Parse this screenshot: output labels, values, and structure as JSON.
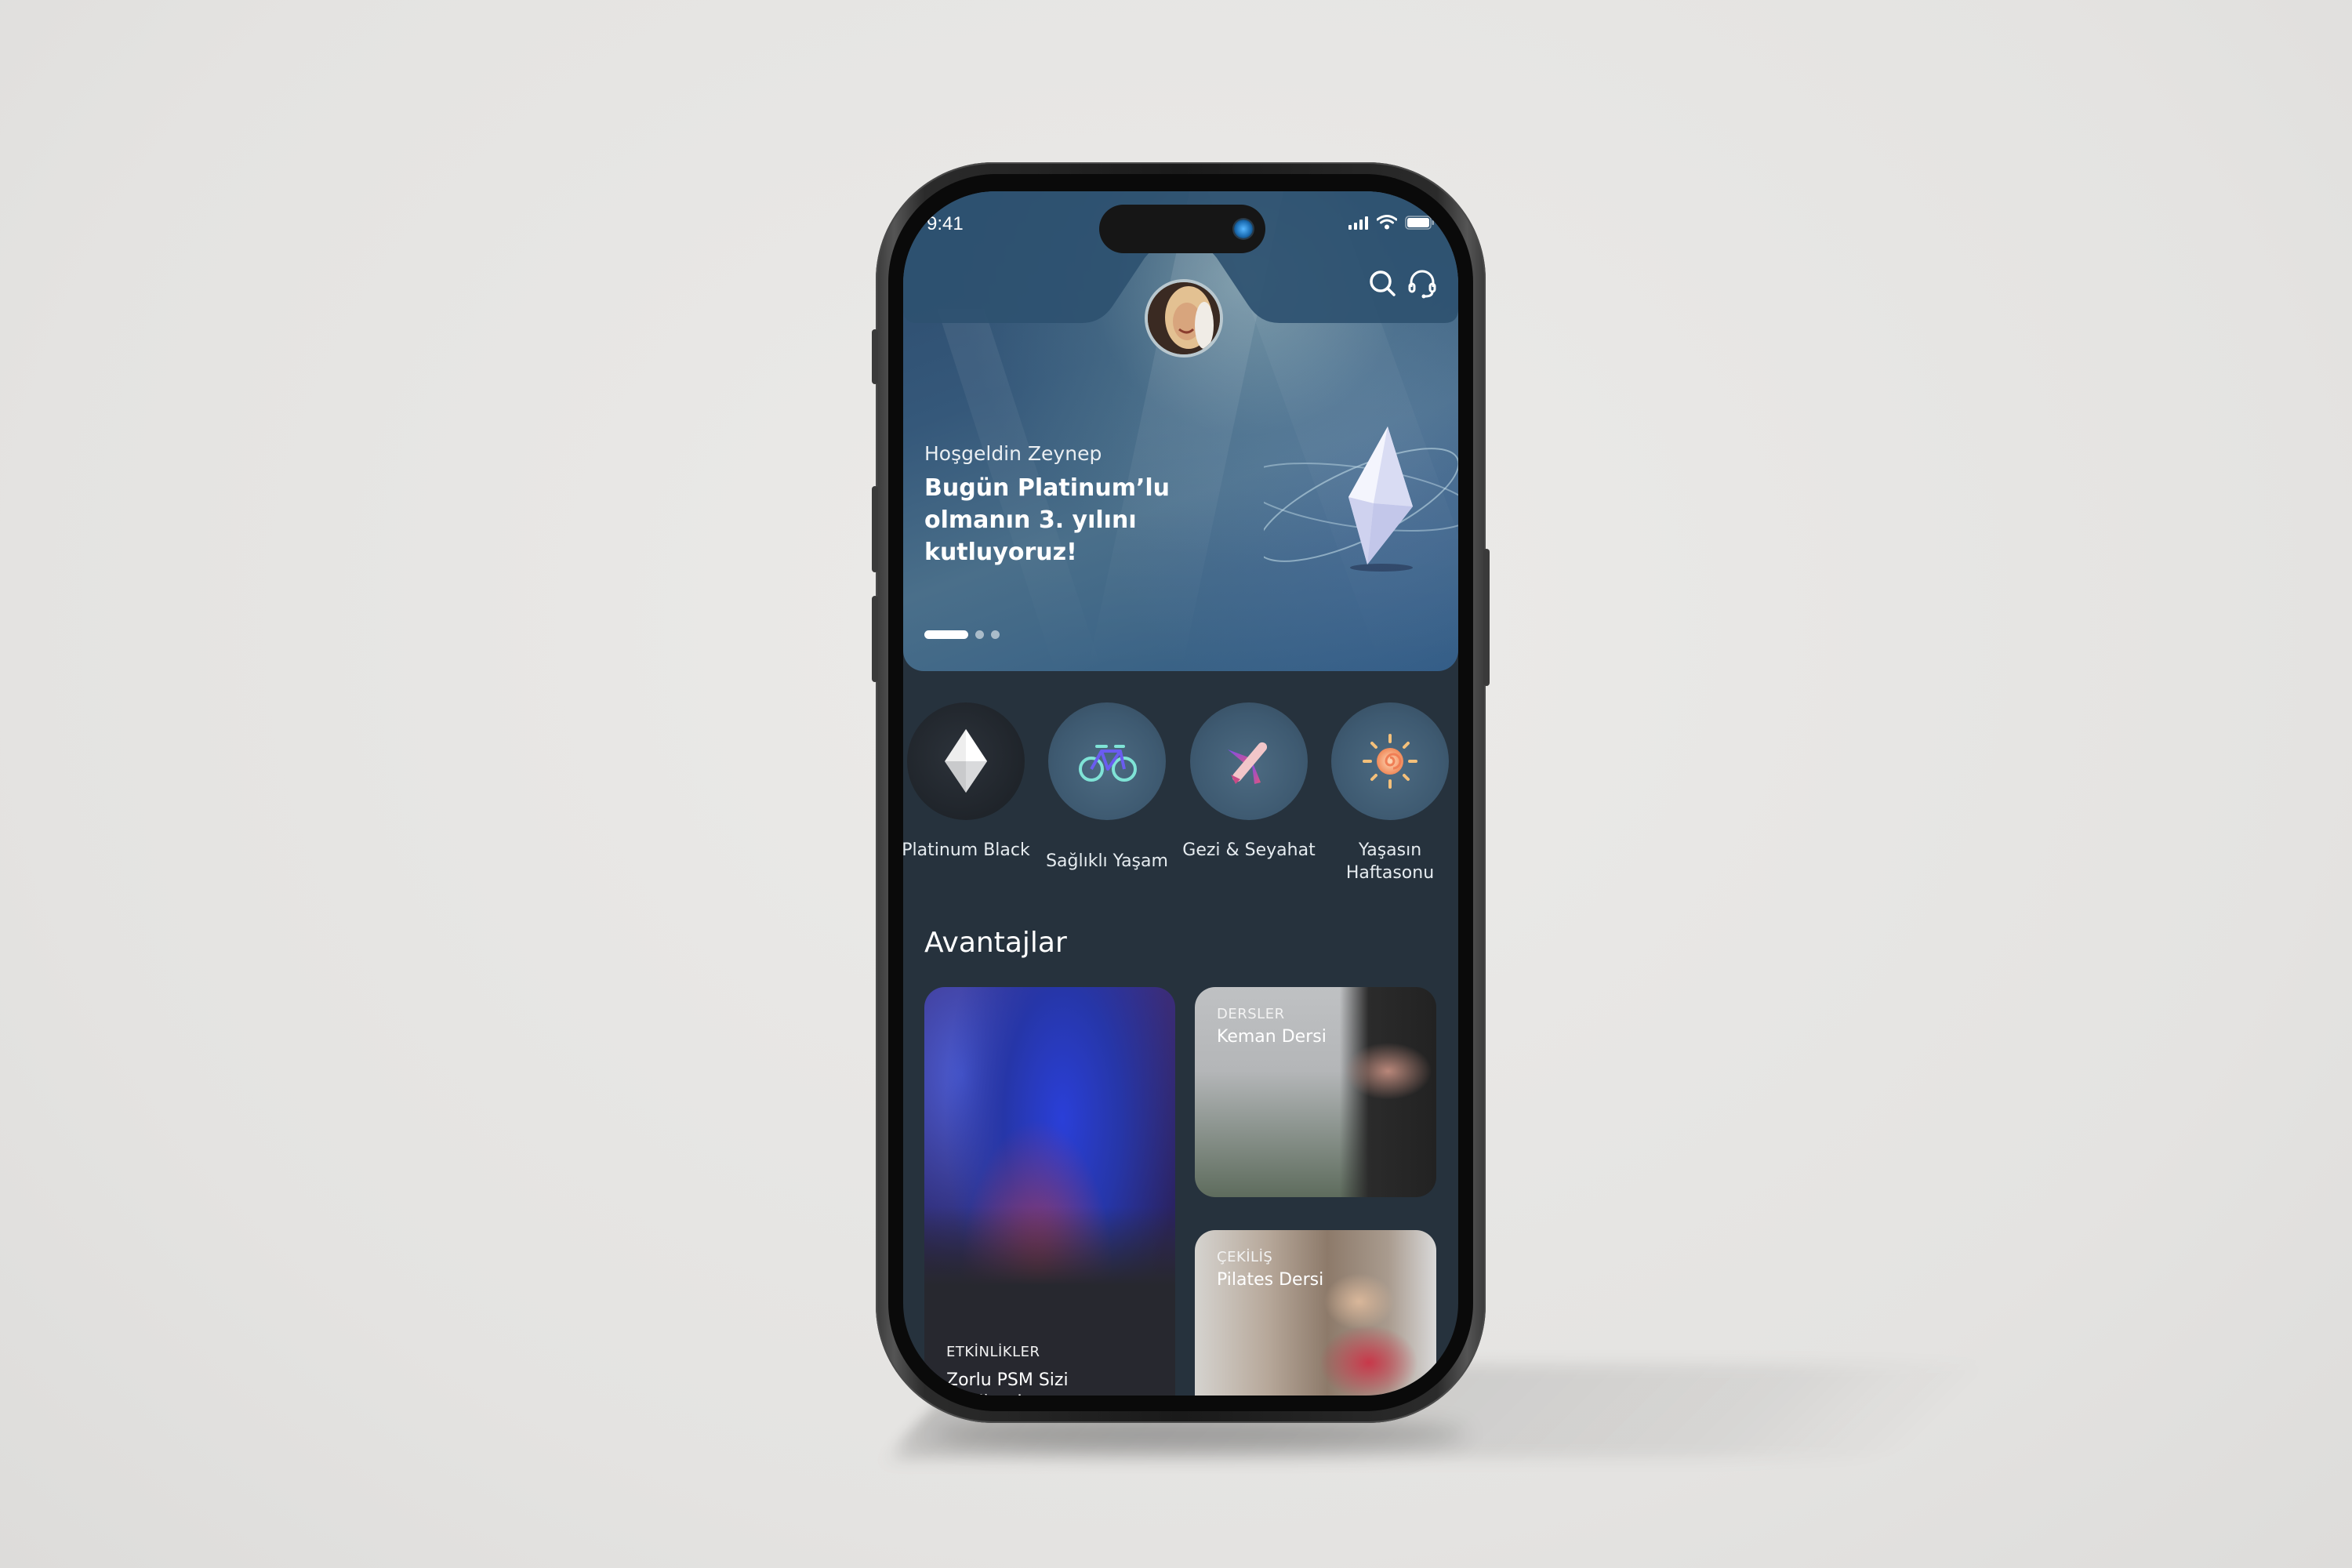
{
  "status_bar": {
    "time": "9:41"
  },
  "header": {
    "search_icon": "search-icon",
    "support_icon": "headset-icon",
    "avatar_alt": "Zeynep profile photo"
  },
  "hero": {
    "greeting": "Hoşgeldin Zeynep",
    "title": "Bugün Platinum’lu olmanın 3. yılını kutluyoruz!",
    "carousel": {
      "total": 3,
      "active": 1
    }
  },
  "categories": [
    {
      "label": "Platinum Black",
      "icon": "diamond-icon"
    },
    {
      "label": "Sağlıklı Yaşam",
      "icon": "bicycle-icon"
    },
    {
      "label": "Gezi & Seyahat",
      "icon": "airplane-icon"
    },
    {
      "label": "Yaşasın Haftasonu",
      "icon": "sun-icon"
    }
  ],
  "advantages": {
    "title": "Avantajlar",
    "cards": [
      {
        "kicker": "ETKİNLİKLER",
        "title": "Zorlu PSM Sizi Bekliyor!"
      },
      {
        "kicker": "DERSLER",
        "title": "Keman Dersi"
      },
      {
        "kicker": "ÇEKİLİŞ",
        "title": "Pilates Dersi"
      }
    ]
  },
  "colors": {
    "app_background": "#26323d",
    "hero_blue": "#35587a",
    "text": "#ffffff"
  }
}
